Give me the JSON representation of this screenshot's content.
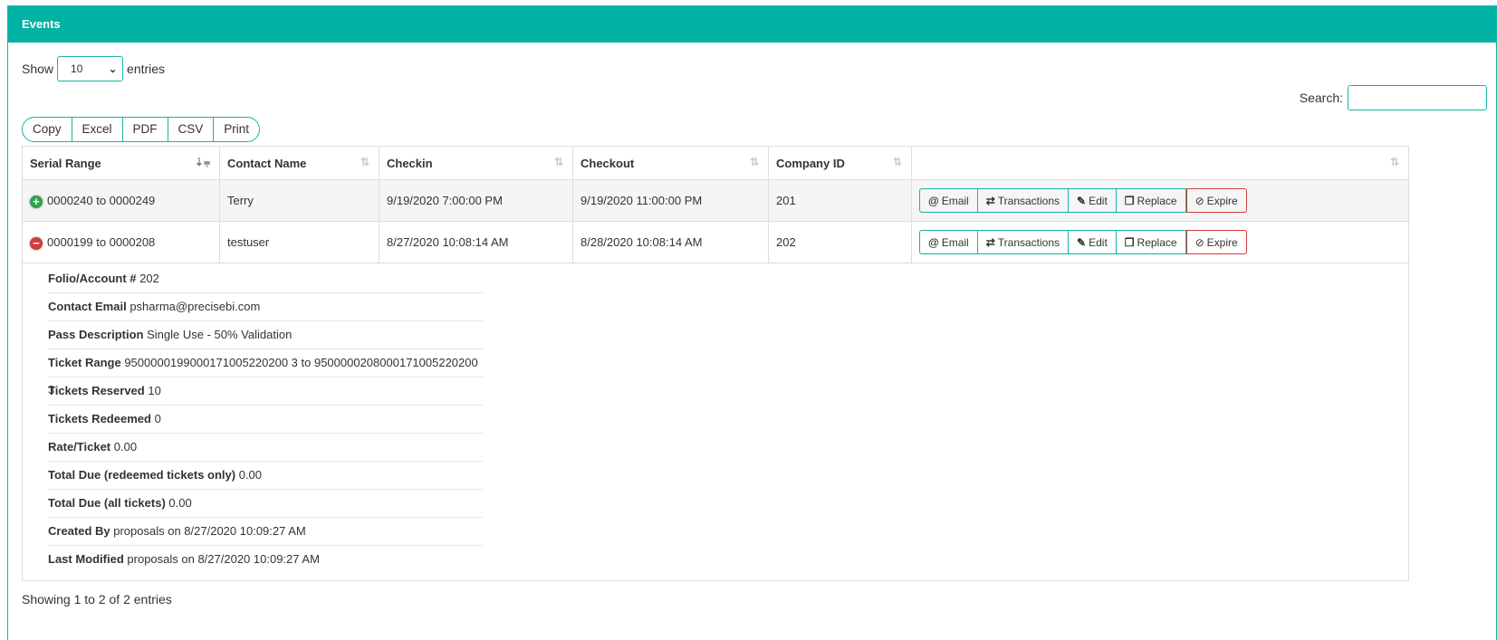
{
  "header": {
    "title": "Events"
  },
  "length": {
    "show_label": "Show",
    "value": "10",
    "entries_label": "entries"
  },
  "search": {
    "label": "Search:",
    "value": ""
  },
  "export_buttons": [
    "Copy",
    "Excel",
    "PDF",
    "CSV",
    "Print"
  ],
  "columns": [
    "Serial Range",
    "Contact Name",
    "Checkin",
    "Checkout",
    "Company ID",
    ""
  ],
  "rows": [
    {
      "serial": "0000240 to 0000249",
      "contact": "Terry",
      "checkin": "9/19/2020 7:00:00 PM",
      "checkout": "9/19/2020 11:00:00 PM",
      "company": "201"
    },
    {
      "serial": "0000199 to 0000208",
      "contact": "testuser",
      "checkin": "8/27/2020 10:08:14 AM",
      "checkout": "8/28/2020 10:08:14 AM",
      "company": "202"
    }
  ],
  "actions": {
    "email": "Email",
    "transactions": "Transactions",
    "edit": "Edit",
    "replace": "Replace",
    "expire": "Expire"
  },
  "details": [
    {
      "label": "Folio/Account #",
      "value": "202"
    },
    {
      "label": "Contact Email",
      "value": "psharma@precisebi.com"
    },
    {
      "label": "Pass Description",
      "value": "Single Use - 50% Validation"
    },
    {
      "label": "Ticket Range",
      "value": "9500000199000171005220200 3 to 9500000208000171005220200 3"
    },
    {
      "label": "Tickets Reserved",
      "value": "10"
    },
    {
      "label": "Tickets Redeemed",
      "value": "0"
    },
    {
      "label": "Rate/Ticket ",
      "value": "0.00"
    },
    {
      "label": "Total Due (redeemed tickets only)",
      "value": "0.00"
    },
    {
      "label": "Total Due (all tickets)",
      "value": "0.00"
    },
    {
      "label": "Created By ",
      "value": "proposals on 8/27/2020 10:09:27 AM"
    },
    {
      "label": "Last Modified",
      "value": "proposals on 8/27/2020 10:09:27 AM"
    }
  ],
  "footer": {
    "info": "Showing 1 to 2 of 2 entries"
  },
  "colors": {
    "accent": "#00b3a4",
    "danger": "#d33c3c",
    "success": "#2ea44f"
  }
}
